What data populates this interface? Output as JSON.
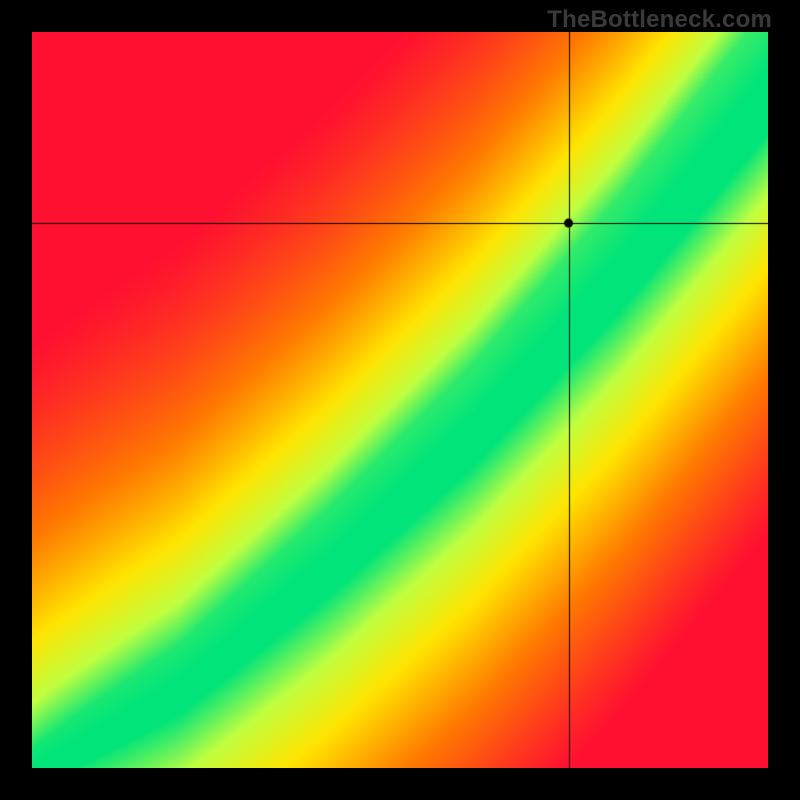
{
  "watermark": "TheBottleneck.com",
  "chart_data": {
    "type": "heatmap",
    "title": "",
    "xlabel": "",
    "ylabel": "",
    "xlim": [
      0,
      100
    ],
    "ylim": [
      0,
      100
    ],
    "crosshair": {
      "x": 73,
      "y": 74
    },
    "marker": {
      "x": 73,
      "y": 74
    },
    "optimal_band": {
      "description": "green diagonal band where GPU and CPU balance near y ≈ x^1.25",
      "points_center": [
        {
          "x": 0,
          "y": 0
        },
        {
          "x": 20,
          "y": 12
        },
        {
          "x": 40,
          "y": 29
        },
        {
          "x": 60,
          "y": 48
        },
        {
          "x": 80,
          "y": 70
        },
        {
          "x": 100,
          "y": 95
        }
      ],
      "half_width_percent": 7
    },
    "color_scale": {
      "low": "#ff1030",
      "mid_low": "#ff7a00",
      "mid": "#ffe400",
      "mid_high": "#c0ff40",
      "high": "#00e47a"
    }
  }
}
